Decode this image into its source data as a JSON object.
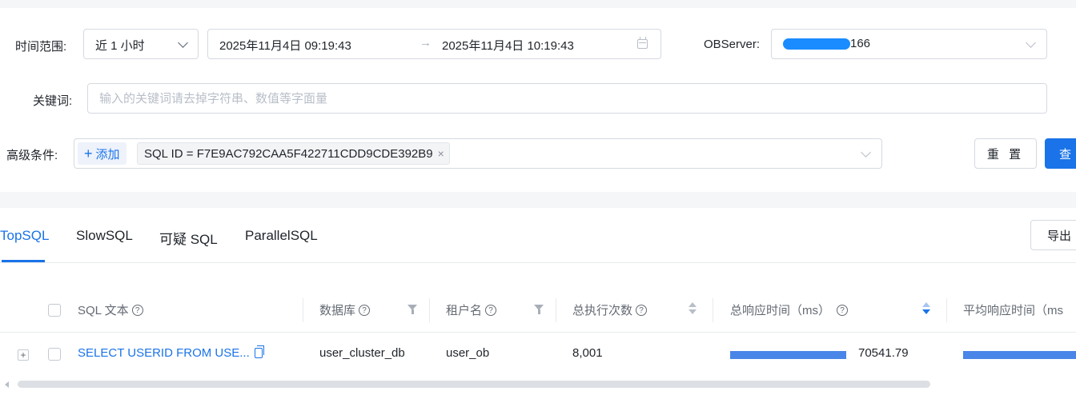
{
  "filters": {
    "time_range_label": "时间范围:",
    "time_range_value": "近 1 小时",
    "start_time": "2025年11月4日 09:19:43",
    "end_time": "2025年11月4日 10:19:43",
    "range_arrow": "→",
    "server_label": "OBServer:",
    "server_value_suffix": "166",
    "keyword_label": "关键词:",
    "keyword_placeholder": "输入的关键词请去掉字符串、数值等字面量",
    "keyword_value": "",
    "advanced_label": "高级条件:",
    "add_label": "添加",
    "condition_tag": "SQL ID = F7E9AC792CAA5F422711CDD9CDE392B9",
    "reset_label": "重 置",
    "query_label": "查"
  },
  "tabs": [
    {
      "label": "TopSQL",
      "active": true
    },
    {
      "label": "SlowSQL",
      "active": false
    },
    {
      "label": "可疑 SQL",
      "active": false
    },
    {
      "label": "ParallelSQL",
      "active": false
    }
  ],
  "export_label": "导出",
  "table": {
    "columns": {
      "sql_text": "SQL 文本",
      "database": "数据库",
      "tenant": "租户名",
      "exec_count": "总执行次数",
      "total_response": "总响应时间（ms）",
      "avg_response": "平均响应时间（ms"
    },
    "rows": [
      {
        "sql_text": "SELECT USERID FROM USE...",
        "database": "user_cluster_db",
        "tenant": "user_ob",
        "exec_count": "8,001",
        "total_response": "70541.79",
        "total_response_fraction": 1.0,
        "avg_response_fraction": 1.0
      }
    ]
  },
  "colors": {
    "accent": "#1a73e8",
    "bar": "#4a86e8"
  }
}
